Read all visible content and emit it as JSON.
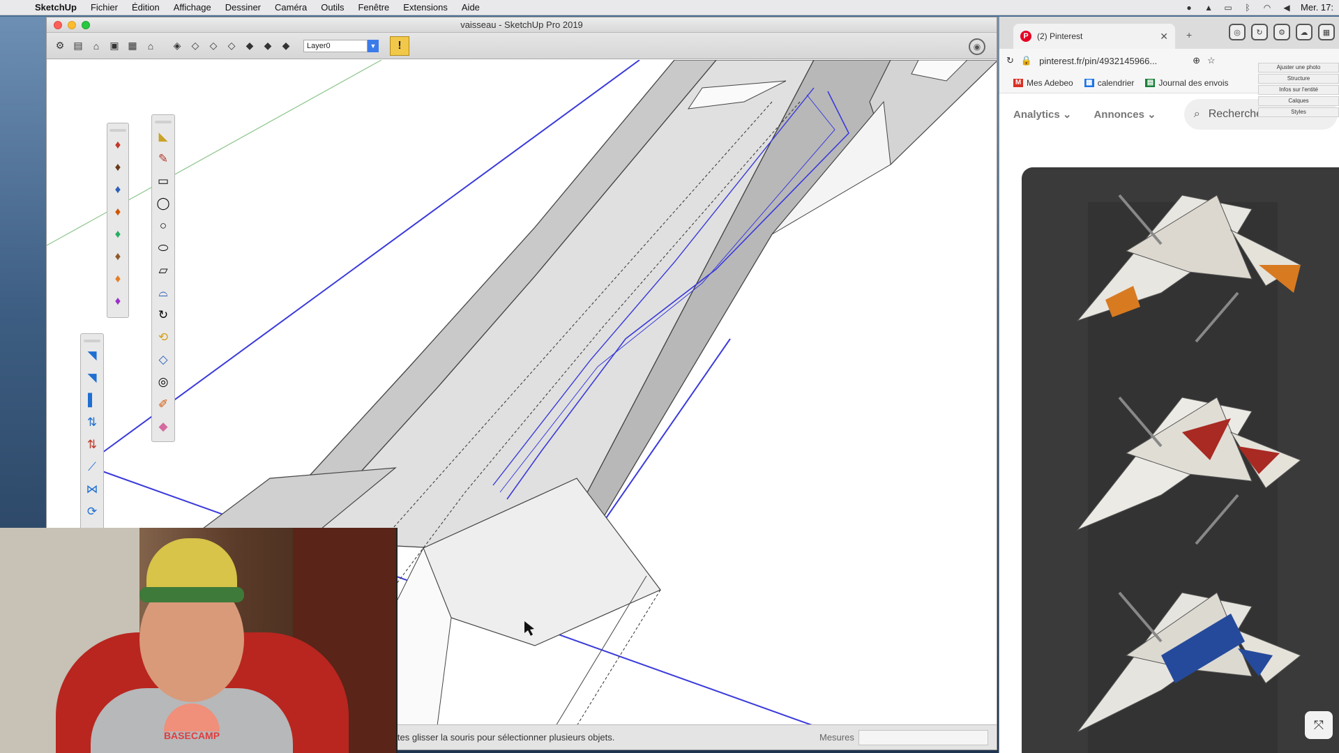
{
  "menubar": {
    "app_name": "SketchUp",
    "items": [
      "Fichier",
      "Édition",
      "Affichage",
      "Dessiner",
      "Caméra",
      "Outils",
      "Fenêtre",
      "Extensions",
      "Aide"
    ],
    "clock": "Mer. 17:"
  },
  "sketchup": {
    "title": "vaisseau - SketchUp Pro 2019",
    "layer": "Layer0",
    "status_text": "ites glisser la souris pour sélectionner plusieurs objets.",
    "measure_label": "Mesures",
    "measure_value": ""
  },
  "browser": {
    "tab_title": "(2) Pinterest",
    "url": "pinterest.fr/pin/4932145966...",
    "bookmarks": [
      "Mes Adebeo",
      "calendrier",
      "Journal des envois"
    ],
    "nav": {
      "analytics": "Analytics",
      "annonces": "Annonces",
      "search_placeholder": "Rechercher"
    },
    "side_panel": [
      "Ajuster une photo",
      "Structure",
      "Infos sur l'entité",
      "Calques",
      "Styles"
    ]
  },
  "webcam": {
    "shirt_logo": "BASECAMP"
  }
}
